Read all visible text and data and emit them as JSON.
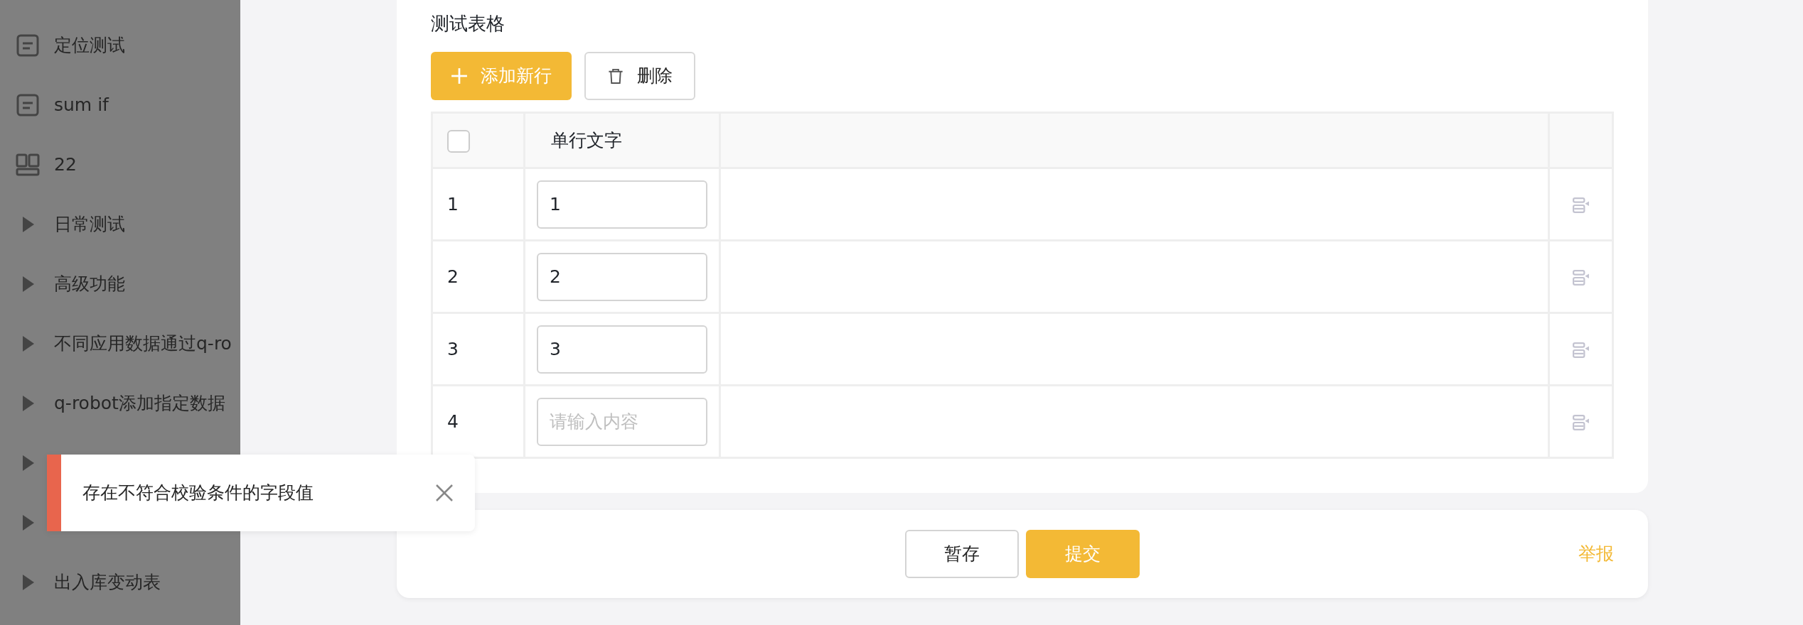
{
  "sidebar": {
    "items": [
      {
        "label": "定位测试",
        "kind": "page"
      },
      {
        "label": "sum if",
        "kind": "page"
      },
      {
        "label": "22",
        "kind": "dashboard"
      },
      {
        "label": "日常测试",
        "kind": "folder"
      },
      {
        "label": "高级功能",
        "kind": "folder"
      },
      {
        "label": "不同应用数据通过q-ro",
        "kind": "folder"
      },
      {
        "label": "q-robot添加指定数据",
        "kind": "folder"
      },
      {
        "kind": "folder"
      },
      {
        "kind": "folder"
      },
      {
        "label": "出入库变动表",
        "kind": "folder"
      }
    ]
  },
  "form": {
    "title": "测试表格",
    "toolbar": [
      {
        "label": "添加新行",
        "kind": "add"
      },
      {
        "label": "删除",
        "kind": "delete"
      }
    ],
    "table": {
      "header_checked": false,
      "columns": [
        "单行文字"
      ],
      "rows": [
        {
          "index": "1",
          "value": "1"
        },
        {
          "index": "2",
          "value": "2"
        },
        {
          "index": "3",
          "value": "3"
        },
        {
          "index": "4",
          "placeholder": "请输入内容"
        }
      ]
    }
  },
  "footer": {
    "buttons": [
      {
        "label": "暂存",
        "kind": "secondary"
      },
      {
        "label": "提交",
        "kind": "primary"
      }
    ],
    "link": "举报"
  },
  "toast": {
    "kind": "error",
    "message": "存在不符合校验条件的字段值"
  }
}
